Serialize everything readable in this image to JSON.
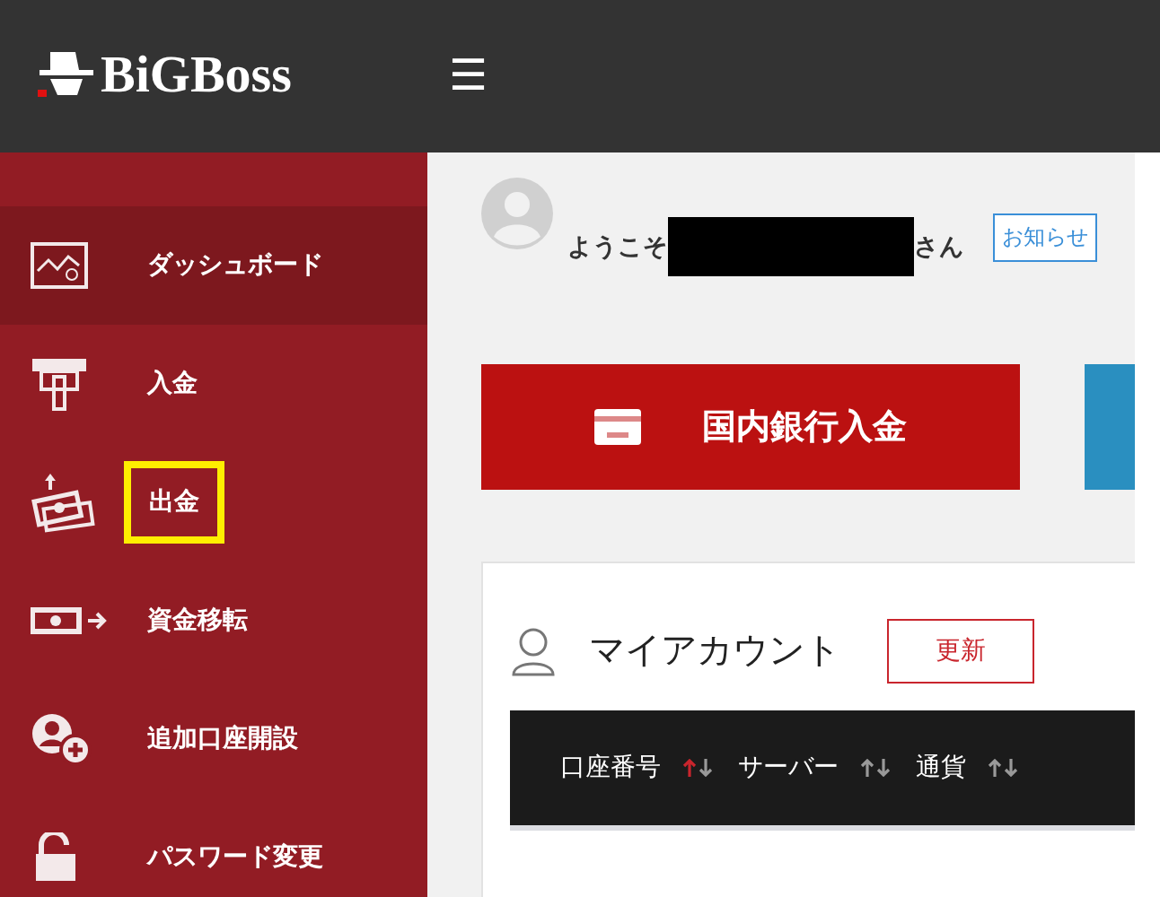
{
  "header": {
    "logo": "BiGBoss",
    "menu_icon": "☰"
  },
  "sidebar": {
    "items": [
      {
        "label": "ダッシュボード",
        "selected": true,
        "highlighted": false
      },
      {
        "label": "入金",
        "selected": false,
        "highlighted": false
      },
      {
        "label": "出金",
        "selected": false,
        "highlighted": true
      },
      {
        "label": "資金移転",
        "selected": false,
        "highlighted": false
      },
      {
        "label": "追加口座開設",
        "selected": false,
        "highlighted": false
      },
      {
        "label": "パスワード変更",
        "selected": false,
        "highlighted": false
      }
    ]
  },
  "welcome": {
    "prefix": "ようこそ",
    "suffix": "さん",
    "name_redacted": true,
    "notice_button": "お知らせ"
  },
  "tiles": [
    {
      "label": "国内銀行入金",
      "color": "#bb1111"
    },
    {
      "color": "#2a8fc0"
    }
  ],
  "account_card": {
    "title": "マイアカウント",
    "refresh_button": "更新",
    "columns": [
      {
        "label": "口座番号",
        "sorted": true
      },
      {
        "label": "サーバー",
        "sorted": false
      },
      {
        "label": "通貨",
        "sorted": false
      }
    ]
  }
}
